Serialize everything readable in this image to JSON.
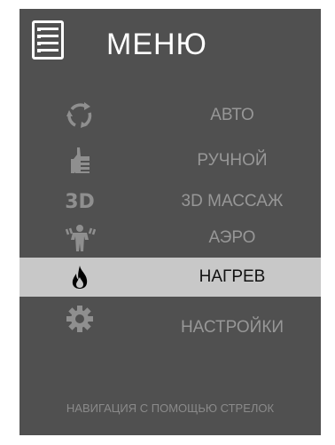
{
  "menu": {
    "title": "МЕНЮ",
    "items": [
      {
        "label": "АВТО",
        "icon": "refresh-icon",
        "active": false
      },
      {
        "label": "РУЧНОЙ",
        "icon": "thumbs-up-icon",
        "active": false
      },
      {
        "label": "3D МАССАЖ",
        "icon": "3d-icon",
        "icon_text": "3D",
        "active": false
      },
      {
        "label": "АЭРО",
        "icon": "body-air-icon",
        "active": false
      },
      {
        "label": "НАГРЕВ",
        "icon": "flame-icon",
        "active": true
      },
      {
        "label": "НАСТРОЙКИ",
        "icon": "gear-icon",
        "active": false
      }
    ],
    "hint": "НАВИГАЦИЯ С ПОМОЩЬЮ СТРЕЛОК"
  },
  "colors": {
    "panel_bg": "#505050",
    "active_bg": "#c8c8c8",
    "label": "#979797",
    "active_label": "#111111",
    "icon": "#8f8f8f"
  }
}
